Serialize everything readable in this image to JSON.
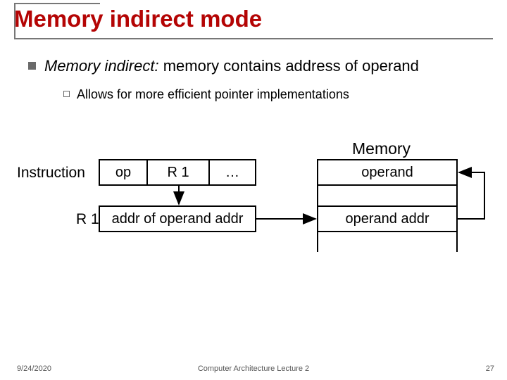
{
  "title": "Memory indirect mode",
  "bullet1_term": "Memory indirect:",
  "bullet1_rest": " memory contains address of operand",
  "bullet2": "Allows for more efficient pointer implementations",
  "labels": {
    "memory": "Memory",
    "instruction": "Instruction",
    "r1_left": "R 1"
  },
  "instruction_cells": {
    "op": "op",
    "r1": "R 1",
    "dots": "…"
  },
  "r1_box": "addr of operand addr",
  "memory_cells": {
    "c0": "operand",
    "c2": "operand addr"
  },
  "footer": {
    "date": "9/24/2020",
    "mid": "Computer Architecture Lecture 2",
    "page": "27"
  }
}
